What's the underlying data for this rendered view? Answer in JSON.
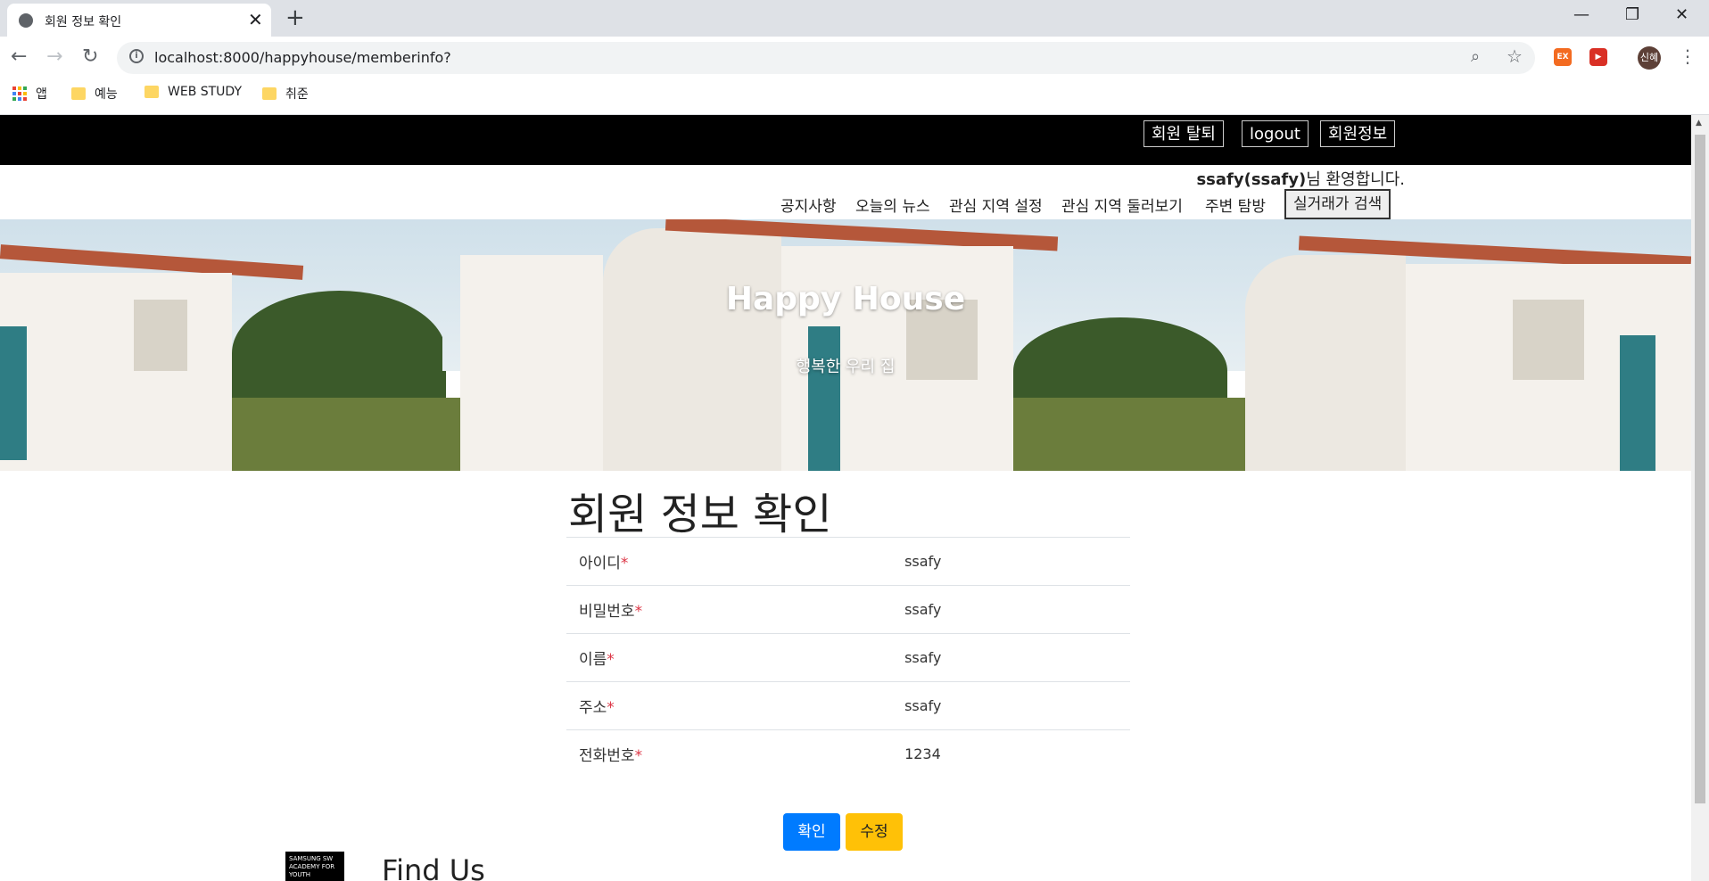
{
  "browser": {
    "tab_title": "회원 정보 확인",
    "url": "localhost:8000/happyhouse/memberinfo?",
    "profile_initials": "신혜",
    "bookmarks": [
      {
        "label": "앱",
        "icon": "apps-grid-icon"
      },
      {
        "label": "예능",
        "icon": "folder-icon"
      },
      {
        "label": "WEB STUDY",
        "icon": "folder-icon"
      },
      {
        "label": "취준",
        "icon": "folder-icon"
      }
    ],
    "extensions": [
      {
        "label": "EX",
        "color": "#f36b21"
      },
      {
        "label": "▶",
        "color": "#d93025"
      }
    ]
  },
  "header": {
    "buttons": [
      "회원 탈퇴",
      "logout",
      "회원정보"
    ],
    "welcome_user": "ssafy(ssafy)",
    "welcome_suffix": "님 환영합니다.",
    "nav": [
      "공지사항",
      "오늘의 뉴스",
      "관심 지역 설정",
      "관심 지역 둘러보기",
      "주변 탐방"
    ],
    "nav_search": "실거래가 검색"
  },
  "hero": {
    "title": "Happy House",
    "subtitle": "행복한 우리 집"
  },
  "main": {
    "title": "회원 정보 확인",
    "rows": [
      {
        "label": "아이디",
        "value": "ssafy"
      },
      {
        "label": "비밀번호",
        "value": "ssafy"
      },
      {
        "label": "이름",
        "value": "ssafy"
      },
      {
        "label": "주소",
        "value": "ssafy"
      },
      {
        "label": "전화번호",
        "value": "1234"
      }
    ],
    "required_mark": "*",
    "confirm_label": "확인",
    "edit_label": "수정"
  },
  "footer": {
    "logo_text": "SAMSUNG SW ACADEMY FOR YOUTH",
    "title": "Find Us"
  },
  "colors": {
    "primary": "#007bff",
    "warning": "#ffc107",
    "required": "#dc3545"
  }
}
